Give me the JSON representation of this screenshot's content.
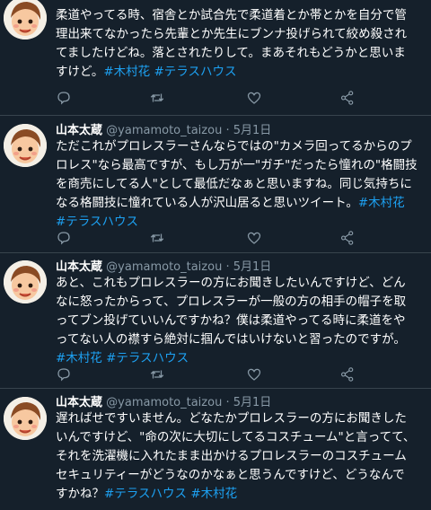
{
  "icons": {
    "reply": "reply-icon",
    "retweet": "retweet-icon",
    "like": "like-icon",
    "share": "share-icon"
  },
  "colors": {
    "background": "#15202b",
    "text": "#ffffff",
    "muted": "#8899a6",
    "hashtag": "#1da1f2",
    "divider": "#38444d"
  },
  "tweets": [
    {
      "name": "",
      "handle": "",
      "time": "",
      "lines": [
        "柔道やってる時、宿舎とか試合先で柔道着とか帯とかを自分で管",
        "理出来てなかったら先輩とか先生にブンナ投げられて絞め殺され",
        "てましたけどね。落とされたりして。まあそれもどうかと思いま"
      ],
      "last_text": "すけど。",
      "tags": [
        "#木村花",
        "#テラスハウス"
      ]
    },
    {
      "name": "山本太蔵",
      "handle": "@yamamoto_taizou",
      "time": "· 5月1日",
      "lines": [
        "ただこれがプロレスラーさんならではの\"カメラ回ってるからのプ",
        "ロレス\"なら最高ですが、もし万が一\"ガチ\"だったら憧れの\"格闘技",
        "を商売にしてる人\"として最低だなぁと思いますね。同じ気持ちに"
      ],
      "last_text": "なる格闘技に憧れている人が沢山居ると思いツイート。",
      "tags": [
        "#木村花",
        "#テラスハウス"
      ]
    },
    {
      "name": "山本太蔵",
      "handle": "@yamamoto_taizou",
      "time": "· 5月1日",
      "lines": [
        "あと、これもプロレスラーの方にお聞きしたいんですけど、どん",
        "なに怒ったからって、プロレスラーが一般の方の相手の帽子を取",
        "ってブン投げていいんですかね？僕は柔道やってる時に柔道をや",
        "ってない人の襟すら絶対に掴んではいけないと習ったのですが。"
      ],
      "last_text": "",
      "tags": [
        "#木村花",
        "#テラスハウス"
      ]
    },
    {
      "name": "山本太蔵",
      "handle": "@yamamoto_taizou",
      "time": "· 5月1日",
      "lines": [
        "遅ればせですいません。どなたかプロレスラーの方にお聞きした",
        "いんですけど、\"命の次に大切にしてるコスチューム\"と言ってて、",
        "それを洗濯機に入れたまま出かけるプロレスラーのコスチューム",
        "セキュリティーがどうなのかなぁと思うんですけど、どうなんで"
      ],
      "last_text": "すかね？",
      "tags": [
        "#テラスハウス",
        "#木村花"
      ]
    }
  ]
}
